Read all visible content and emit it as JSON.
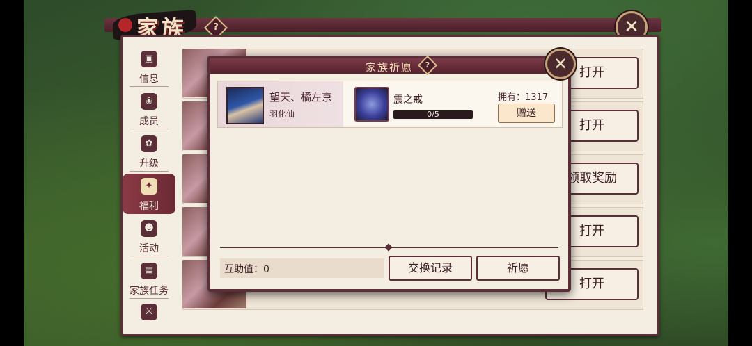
{
  "panel": {
    "title": "家族",
    "help_icon": "?"
  },
  "side_nav": {
    "items": [
      {
        "label": "信息",
        "icon": "info-icon"
      },
      {
        "label": "成员",
        "icon": "members-icon"
      },
      {
        "label": "升级",
        "icon": "upgrade-icon"
      },
      {
        "label": "福利",
        "icon": "welfare-icon",
        "active": true
      },
      {
        "label": "活动",
        "icon": "activity-icon"
      },
      {
        "label": "家族任务",
        "icon": "task-icon"
      }
    ]
  },
  "rows": {
    "buttons": [
      "打开",
      "打开",
      "领取奖励",
      "打开",
      "打开"
    ]
  },
  "wish_modal": {
    "title": "家族祈愿",
    "help_icon": "?",
    "character": {
      "name": "望天、橘左京",
      "title": "羽化仙"
    },
    "item": {
      "name": "震之戒",
      "progress_text": "0/5",
      "progress_fraction": 0
    },
    "owned_text": "拥有：1317",
    "gift_button": "赠送",
    "mutual_aid": "互助值：0",
    "exchange_button": "交换记录",
    "wish_button": "祈愿"
  },
  "colors": {
    "frame": "#5a2f38",
    "panel_bg": "#f4ede2",
    "accent_gold": "#c9a47a"
  }
}
